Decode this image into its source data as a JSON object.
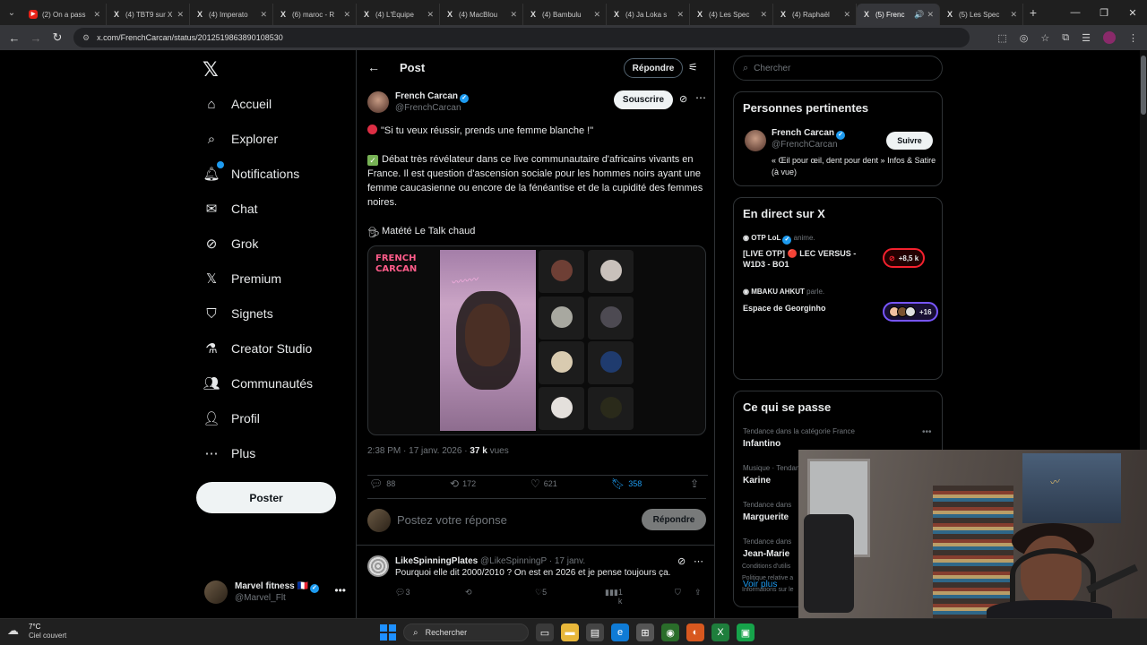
{
  "browser": {
    "tabs": [
      {
        "label": "(2) On a pass",
        "icon": "youtube-icon"
      },
      {
        "label": "(4) TBT9 sur X",
        "icon": "x-icon"
      },
      {
        "label": "(4) Imperato",
        "icon": "x-icon"
      },
      {
        "label": "(6) maroc - R",
        "icon": "x-icon"
      },
      {
        "label": "(4) L'Équipe",
        "icon": "x-icon"
      },
      {
        "label": "(4) MacBlou",
        "icon": "x-icon"
      },
      {
        "label": "(4) Bambulu",
        "icon": "x-icon"
      },
      {
        "label": "(4) Ja Loka s",
        "icon": "x-icon"
      },
      {
        "label": "(4) Les Spec",
        "icon": "x-icon"
      },
      {
        "label": "(4) Raphaël",
        "icon": "x-icon"
      },
      {
        "label": "(5) Frenc",
        "icon": "x-icon",
        "active": true
      },
      {
        "label": "(5) Les Spec",
        "icon": "x-icon"
      }
    ],
    "url": "x.com/FrenchCarcan/status/2012519863890108530"
  },
  "nav": {
    "items": [
      {
        "label": "Accueil",
        "icon": "home-icon"
      },
      {
        "label": "Explorer",
        "icon": "search-icon"
      },
      {
        "label": "Notifications",
        "icon": "bell-icon"
      },
      {
        "label": "Chat",
        "icon": "mail-icon"
      },
      {
        "label": "Grok",
        "icon": "grok-icon"
      },
      {
        "label": "Premium",
        "icon": "x-logo-icon"
      },
      {
        "label": "Signets",
        "icon": "bookmark-icon"
      },
      {
        "label": "Creator Studio",
        "icon": "flask-icon"
      },
      {
        "label": "Communautés",
        "icon": "people-icon"
      },
      {
        "label": "Profil",
        "icon": "person-icon"
      },
      {
        "label": "Plus",
        "icon": "more-circle-icon"
      }
    ],
    "post_label": "Poster",
    "account": {
      "name": "Marvel fitness",
      "handle": "@Marvel_Flt"
    }
  },
  "header": {
    "title": "Post",
    "reply_label": "Répondre"
  },
  "tweet": {
    "author": "French Carcan",
    "handle": "@FrenchCarcan",
    "subscribe_label": "Souscrire",
    "line1": "\"Si tu veux réussir, prends une femme blanche !\"",
    "line2": "Débat très révélateur dans ce live communautaire d'africains vivants en France. Il est question d'ascension sociale pour les hommes noirs ayant une femme caucasienne ou encore de la fénéantise et de la cupidité des femmes noires.",
    "line3": "Matété Le Talk chaud",
    "media_logo": "FRENCH CARCAN",
    "time": "2:38 PM · 17 janv. 2026 · ",
    "views": "37 k",
    "views_suffix": " vues",
    "replies": "88",
    "retweets": "172",
    "likes": "621",
    "bookmarks": "358"
  },
  "compose": {
    "placeholder": "Postez votre réponse",
    "button": "Répondre"
  },
  "reply": {
    "name": "LikeSpinningPlates",
    "handle": "@LikeSpinningP · 17 janv.",
    "text": "Pourquoi elle dit 2000/2010 ? On est en 2026 et je pense toujours ça.",
    "replies": "3",
    "likes": "5",
    "views": "1 k"
  },
  "sidebar": {
    "search_placeholder": "Chercher",
    "relevant": {
      "title": "Personnes pertinentes",
      "name": "French Carcan",
      "handle": "@FrenchCarcan",
      "bio": "« Œil pour œil, dent pour dent » Infos & Satire (à vue)",
      "follow_label": "Suivre"
    },
    "live": {
      "title": "En direct sur X",
      "items": [
        {
          "host": "OTP LoL",
          "host_rest": " anime.",
          "title": "[LIVE OTP] 🔴 LEC VERSUS - W1D3 - BO1",
          "badge": "+8,5 k"
        },
        {
          "host": "MBAKU AHKUT",
          "host_rest": " parle.",
          "title": "Espace de Georginho",
          "badge": "+16"
        }
      ]
    },
    "trends": {
      "title": "Ce qui se passe",
      "items": [
        {
          "category": "Tendance dans la catégorie France",
          "name": "Infantino"
        },
        {
          "category": "Musique · Tendances",
          "name": "Karine"
        },
        {
          "category": "Tendance dans",
          "name": "Marguerite"
        },
        {
          "category": "Tendance dans",
          "name": "Jean-Marie"
        }
      ],
      "see_more": "Voir plus"
    },
    "footer": [
      "Conditions d'utilis",
      "Politique relative a",
      "Informations sur le"
    ]
  },
  "taskbar": {
    "temp": "7°C",
    "weather": "Ciel couvert",
    "search": "Rechercher"
  },
  "colors": {
    "accent": "#1d9bf0",
    "live_red": "#f4212e",
    "live_purple": "#7856ff"
  }
}
